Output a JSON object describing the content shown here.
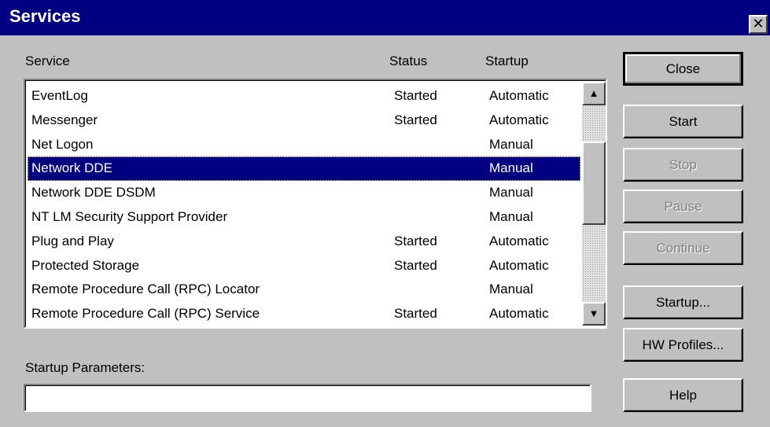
{
  "window": {
    "title": "Services",
    "close_glyph": "✕"
  },
  "columns": {
    "service": "Service",
    "status": "Status",
    "startup": "Startup"
  },
  "services": [
    {
      "name": "EventLog",
      "status": "Started",
      "startup": "Automatic"
    },
    {
      "name": "Messenger",
      "status": "Started",
      "startup": "Automatic"
    },
    {
      "name": "Net Logon",
      "status": "",
      "startup": "Manual"
    },
    {
      "name": "Network DDE",
      "status": "",
      "startup": "Manual",
      "selected": true
    },
    {
      "name": "Network DDE DSDM",
      "status": "",
      "startup": "Manual"
    },
    {
      "name": "NT LM Security Support Provider",
      "status": "",
      "startup": "Manual"
    },
    {
      "name": "Plug and Play",
      "status": "Started",
      "startup": "Automatic"
    },
    {
      "name": "Protected Storage",
      "status": "Started",
      "startup": "Automatic"
    },
    {
      "name": "Remote Procedure Call (RPC) Locator",
      "status": "",
      "startup": "Manual"
    },
    {
      "name": "Remote Procedure Call (RPC) Service",
      "status": "Started",
      "startup": "Automatic"
    }
  ],
  "scrollbar": {
    "up_glyph": "▲",
    "down_glyph": "▼"
  },
  "buttons": {
    "close": "Close",
    "start": "Start",
    "stop": "Stop",
    "pause": "Pause",
    "continue": "Continue",
    "startup": "Startup...",
    "hw_profiles": "HW Profiles...",
    "help": "Help"
  },
  "startup_parameters": {
    "label": "Startup Parameters:",
    "value": ""
  },
  "colors": {
    "title_bar": "#000080",
    "selection": "#000080",
    "face": "#c0c0c0"
  }
}
